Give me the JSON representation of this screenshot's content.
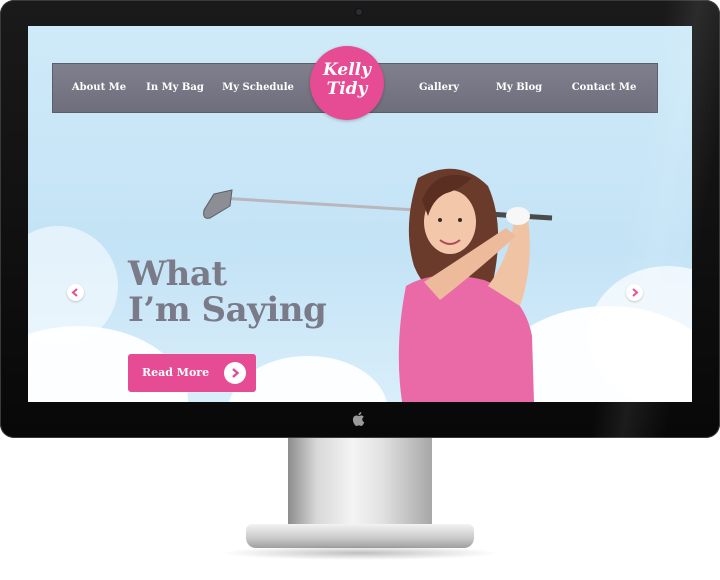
{
  "nav": {
    "left_items": [
      "About Me",
      "In My Bag",
      "My Schedule"
    ],
    "right_items": [
      "Gallery",
      "My Blog",
      "Contact Me"
    ]
  },
  "logo": {
    "line1": "Kelly",
    "line2": "Tidy"
  },
  "hero": {
    "headline_line1": "What",
    "headline_line2": "I’m Saying",
    "cta_label": "Read More"
  },
  "colors": {
    "brand_pink": "#e64c93",
    "nav_gray": "#77768a",
    "sky_blue": "#c8e6f7",
    "headline_gray": "#7b7a88"
  },
  "icons": {
    "prev": "chevron-left-icon",
    "next": "chevron-right-icon",
    "cta": "chevron-right-icon",
    "device": "apple-icon"
  }
}
